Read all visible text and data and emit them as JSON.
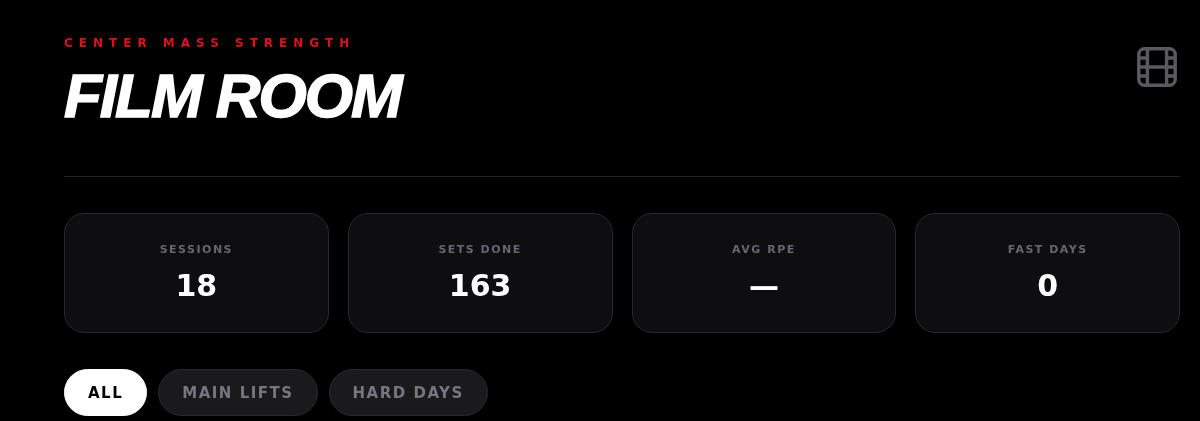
{
  "header": {
    "brand": "CENTER MASS STRENGTH",
    "title": "FILM ROOM"
  },
  "stats": [
    {
      "label": "SESSIONS",
      "value": "18"
    },
    {
      "label": "SETS DONE",
      "value": "163"
    },
    {
      "label": "AVG RPE",
      "value": "—"
    },
    {
      "label": "FAST DAYS",
      "value": "0"
    }
  ],
  "filters": [
    {
      "label": "ALL",
      "selected": true
    },
    {
      "label": "MAIN LIFTS",
      "selected": false
    },
    {
      "label": "HARD DAYS",
      "selected": false
    }
  ]
}
